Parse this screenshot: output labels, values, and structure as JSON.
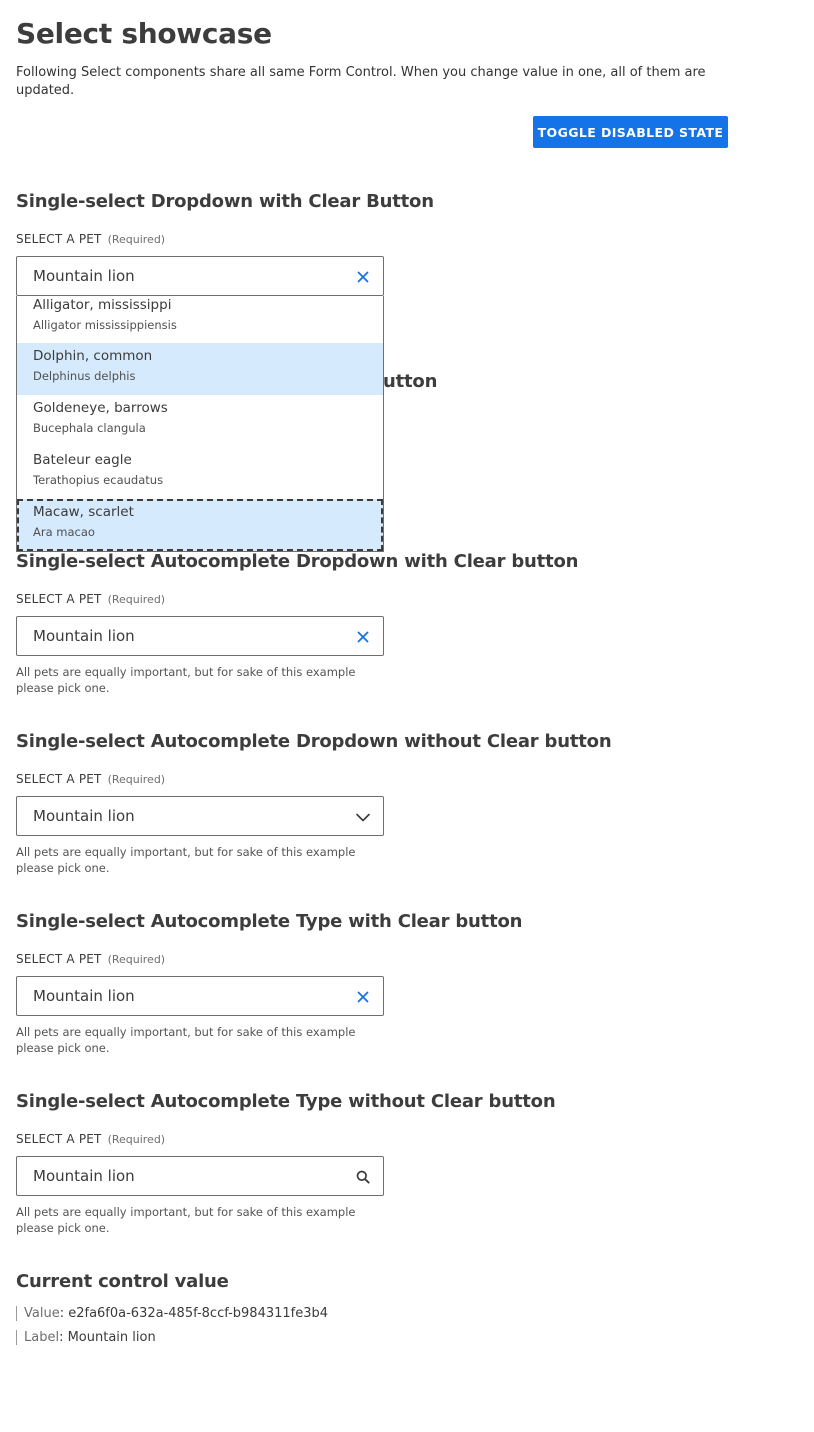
{
  "page": {
    "title": "Select showcase",
    "intro": "Following Select components share all same Form Control. When you change value in one, all of them are updated.",
    "toggle_button": "TOGGLE DISABLED STATE"
  },
  "colors": {
    "accent": "#1473e6",
    "selected_bg": "#d6eafd",
    "border": "#6e6e6e"
  },
  "sections": [
    {
      "title": "Single-select Dropdown with Clear Button",
      "label": "SELECT A PET",
      "required": "(Required)",
      "value": "Mountain lion",
      "icon": "clear-x-icon",
      "dropdown_open": true,
      "options": [
        {
          "name": "Alligator, mississippi",
          "latin": "Alligator mississippiensis"
        },
        {
          "name": "Dolphin, common",
          "latin": "Delphinus delphis"
        },
        {
          "name": "Goldeneye, barrows",
          "latin": "Bucephala clangula"
        },
        {
          "name": "Bateleur eagle",
          "latin": "Terathopius ecaudatus"
        },
        {
          "name": "Macaw, scarlet",
          "latin": "Ara macao"
        }
      ]
    },
    {
      "title_fragment": "utton"
    },
    {
      "title": "Single-select Autocomplete Dropdown with Clear button",
      "label": "SELECT A PET",
      "required": "(Required)",
      "value": "Mountain lion",
      "icon": "clear-x-icon",
      "hint": "All pets are equally important, but for sake of this example please pick one."
    },
    {
      "title": "Single-select Autocomplete Dropdown without Clear button",
      "label": "SELECT A PET",
      "required": "(Required)",
      "value": "Mountain lion",
      "icon": "chevron-down-icon",
      "hint": "All pets are equally important, but for sake of this example please pick one."
    },
    {
      "title": "Single-select Autocomplete Type with Clear button",
      "label": "SELECT A PET",
      "required": "(Required)",
      "value": "Mountain lion",
      "icon": "clear-x-icon",
      "hint": "All pets are equally important, but for sake of this example please pick one."
    },
    {
      "title": "Single-select Autocomplete Type without Clear button",
      "label": "SELECT A PET",
      "required": "(Required)",
      "value": "Mountain lion",
      "icon": "search-icon",
      "hint": "All pets are equally important, but for sake of this example please pick one."
    }
  ],
  "current_value": {
    "title": "Current control value",
    "value_key": "Value",
    "value": "e2fa6f0a-632a-485f-8ccf-b984311fe3b4",
    "label_key": "Label",
    "label": "Mountain lion"
  }
}
